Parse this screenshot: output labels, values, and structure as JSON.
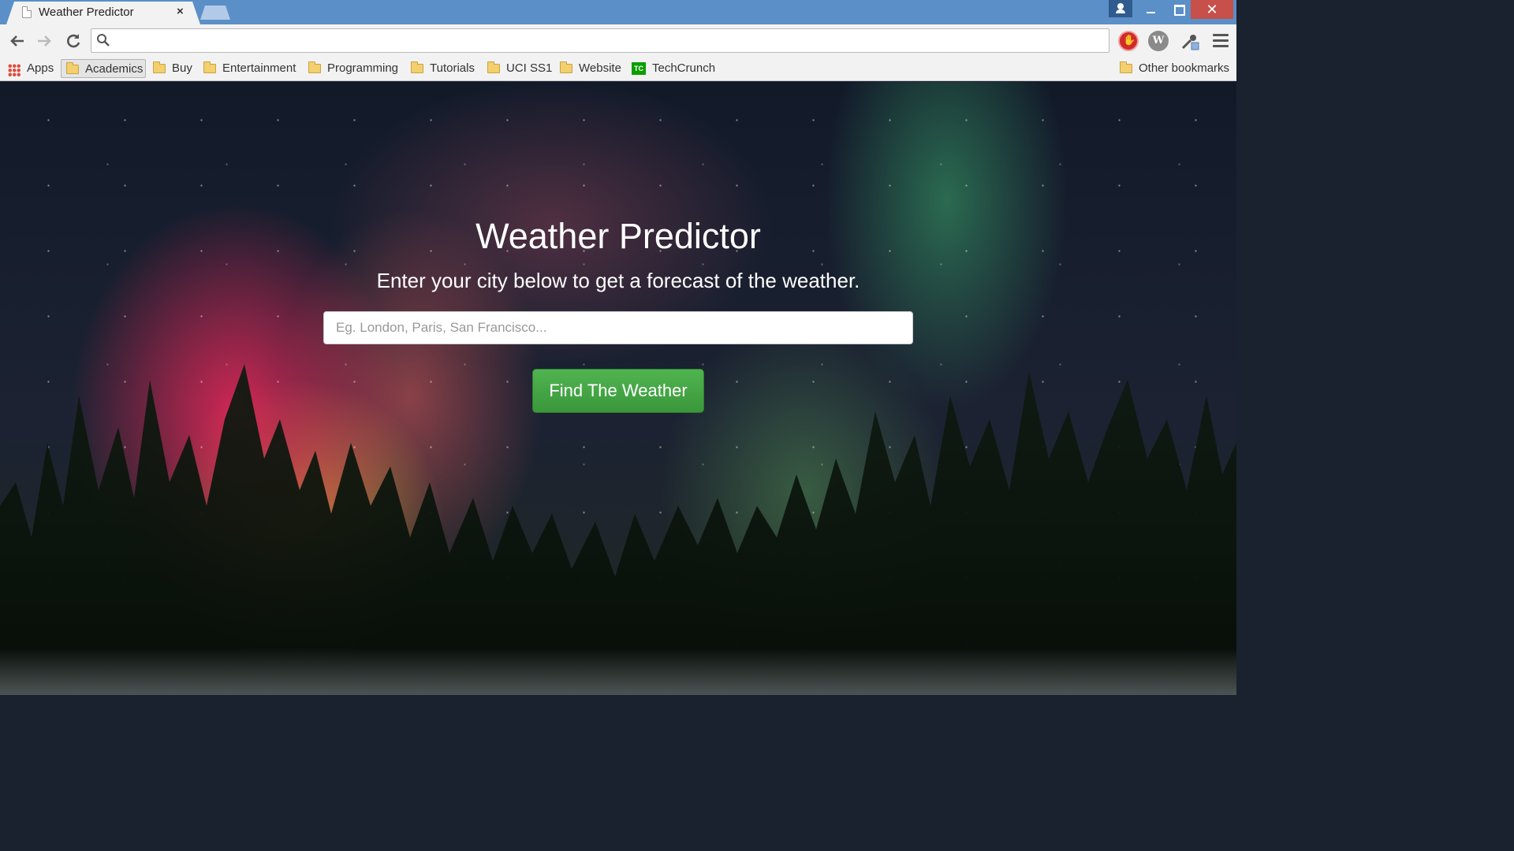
{
  "browser": {
    "tab": {
      "title": "Weather Predictor",
      "close_glyph": "×"
    },
    "omnibox": {
      "value": "",
      "placeholder": ""
    },
    "bookmarks": [
      {
        "label": "Apps",
        "icon": "apps-grid-icon"
      },
      {
        "label": "Academics",
        "icon": "folder-icon"
      },
      {
        "label": "Buy",
        "icon": "folder-icon"
      },
      {
        "label": "Entertainment",
        "icon": "folder-icon"
      },
      {
        "label": "Programming",
        "icon": "folder-icon"
      },
      {
        "label": "Tutorials",
        "icon": "folder-icon"
      },
      {
        "label": "UCI SS1",
        "icon": "folder-icon"
      },
      {
        "label": "Website",
        "icon": "folder-icon"
      },
      {
        "label": "TechCrunch",
        "icon": "techcrunch-icon"
      }
    ],
    "other_bookmarks": "Other bookmarks",
    "extensions": {
      "w_label": "W",
      "tc_label": "TC"
    }
  },
  "page": {
    "title": "Weather Predictor",
    "subtitle": "Enter your city below to get a forecast of the weather.",
    "city_input": {
      "value": "",
      "placeholder": "Eg. London, Paris, San Francisco..."
    },
    "submit_label": "Find The Weather"
  },
  "colors": {
    "titlebar": "#5b8fc7",
    "button_green": "#47a847",
    "close_red": "#c7504a"
  }
}
